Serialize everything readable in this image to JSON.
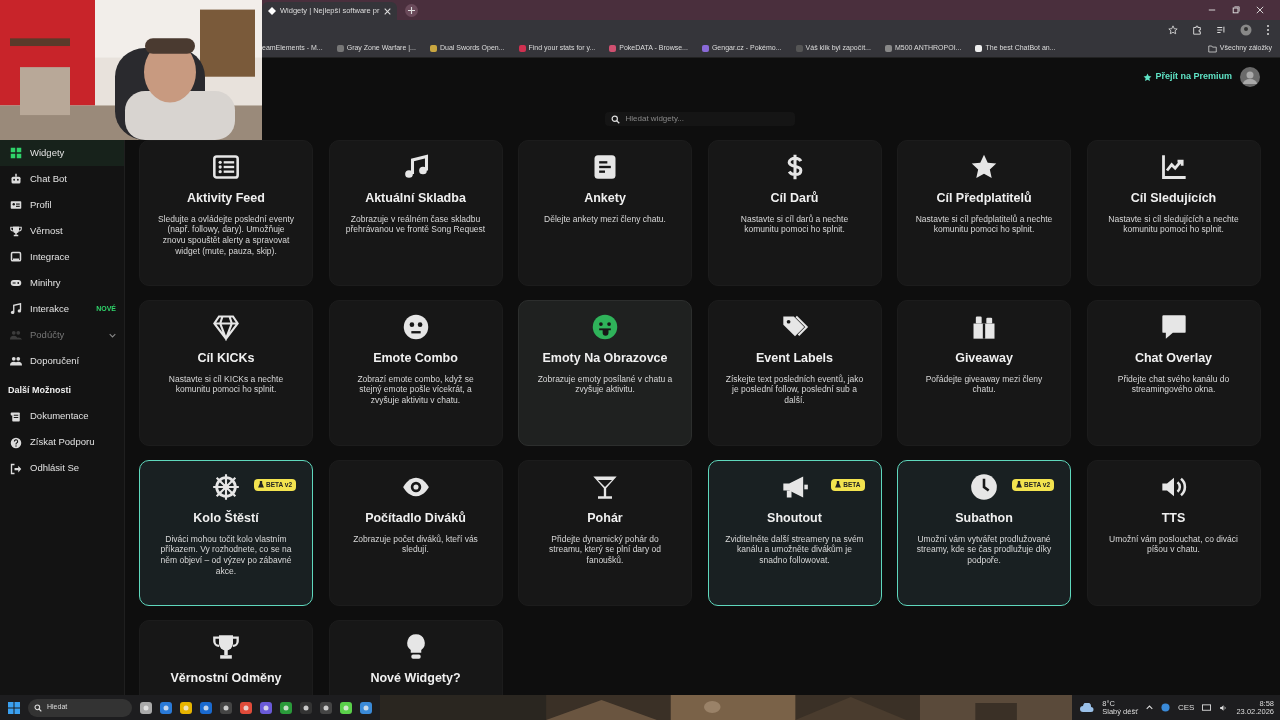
{
  "browser": {
    "tabs": [
      {
        "title": "Widgety | Nejlepší software pr",
        "selected": true
      }
    ],
    "bookmarks": [
      "eamElements - M...",
      "Gray Zone Warfare |...",
      "Dual Swords Open...",
      "Find your stats for y...",
      "PokeDATA - Browse...",
      "Gengar.cz - Pokémo...",
      "Váš klik byl započít...",
      "M500 ANTHROPOI...",
      "The best ChatBot an..."
    ],
    "all_bookmarks": "Všechny záložky"
  },
  "header": {
    "premium": "Přejít na Premium",
    "search": {
      "placeholder": "Hledat widgety..."
    }
  },
  "sidebar": {
    "items": [
      {
        "label": "Widgety",
        "selected": true,
        "disabled": false,
        "expandable": false
      },
      {
        "label": "Chat Bot",
        "selected": false,
        "disabled": false,
        "expandable": false
      },
      {
        "label": "Profil",
        "selected": false,
        "disabled": false,
        "expandable": false
      },
      {
        "label": "Věrnost",
        "selected": false,
        "disabled": false,
        "expandable": false
      },
      {
        "label": "Integrace",
        "selected": false,
        "disabled": false,
        "expandable": false
      },
      {
        "label": "Minihry",
        "selected": false,
        "disabled": false,
        "expandable": false
      },
      {
        "label": "Interakce",
        "selected": false,
        "disabled": false,
        "expandable": false,
        "badge": "NOVÉ"
      },
      {
        "label": "Podúčty",
        "selected": false,
        "disabled": true,
        "expandable": true
      },
      {
        "label": "Doporučení",
        "selected": false,
        "disabled": false,
        "expandable": false
      }
    ],
    "section": "Další Možnosti",
    "more_items": [
      {
        "label": "Dokumentace"
      },
      {
        "label": "Získat Podporu"
      },
      {
        "label": "Odhlásit Se"
      }
    ]
  },
  "widgets": [
    {
      "title": "Aktivity Feed",
      "description": "Sledujte a ovládejte poslední eventy (např. followy, dary). Umožňuje znovu spouštět alerty a spravovat widget (mute, pauza, skip).",
      "highlighted": false,
      "hovered": false
    },
    {
      "title": "Aktuální Skladba",
      "description": "Zobrazuje v reálném čase skladbu přehrávanou ve frontě Song Request",
      "highlighted": false,
      "hovered": false
    },
    {
      "title": "Ankety",
      "description": "Dělejte ankety mezi členy chatu.",
      "highlighted": false,
      "hovered": false
    },
    {
      "title": "Cíl Darů",
      "description": "Nastavte si cíl darů a nechte komunitu pomoci ho splnit.",
      "highlighted": false,
      "hovered": false
    },
    {
      "title": "Cíl Předplatitelů",
      "description": "Nastavte si cíl předplatitelů a nechte komunitu pomoci ho splnit.",
      "highlighted": false,
      "hovered": false
    },
    {
      "title": "Cíl Sledujících",
      "description": "Nastavte si cíl sledujících a nechte komunitu pomoci ho splnit.",
      "highlighted": false,
      "hovered": false
    },
    {
      "title": "Cíl KICKs",
      "description": "Nastavte si cíl KICKs a nechte komunitu pomoci ho splnit.",
      "highlighted": false,
      "hovered": false
    },
    {
      "title": "Emote Combo",
      "description": "Zobrazí emote combo, když se stejný emote pošle vícekrát, a zvyšuje aktivitu v chatu.",
      "highlighted": false,
      "hovered": false
    },
    {
      "title": "Emoty Na Obrazovce",
      "description": "Zobrazuje emoty posílané v chatu a zvyšuje aktivitu.",
      "highlighted": false,
      "hovered": true
    },
    {
      "title": "Event Labels",
      "description": "Získejte text posledních eventů, jako je poslední follow, poslední sub a další.",
      "highlighted": false,
      "hovered": false
    },
    {
      "title": "Giveaway",
      "description": "Pořádejte giveaway mezi členy chatu.",
      "highlighted": false,
      "hovered": false
    },
    {
      "title": "Chat Overlay",
      "description": "Přidejte chat svého kanálu do streamingového okna.",
      "highlighted": false,
      "hovered": false
    },
    {
      "title": "Kolo Štěstí",
      "description": "Diváci mohou točit kolo vlastním příkazem. Vy rozhodnete, co se na něm objeví – od výzev po zábavné akce.",
      "highlighted": true,
      "hovered": false,
      "badge": "BETA v2"
    },
    {
      "title": "Počítadlo Diváků",
      "description": "Zobrazuje počet diváků, kteří vás sledují.",
      "highlighted": false,
      "hovered": false
    },
    {
      "title": "Pohár",
      "description": "Přidejte dynamický pohár do streamu, který se plní dary od fanoušků.",
      "highlighted": false,
      "hovered": false
    },
    {
      "title": "Shoutout",
      "description": "Zviditelněte další streamery na svém kanálu a umožněte divákům je snadno followovat.",
      "highlighted": true,
      "hovered": false,
      "badge": "BETA"
    },
    {
      "title": "Subathon",
      "description": "Umožní vám vytvářet prodlužované streamy, kde se čas prodlužuje díky podpoře.",
      "highlighted": true,
      "hovered": false,
      "badge": "BETA v2"
    },
    {
      "title": "TTS",
      "description": "Umožní vám poslouchat, co diváci píšou v chatu.",
      "highlighted": false,
      "hovered": false
    },
    {
      "title": "Věrnostní Odměny",
      "highlighted": false,
      "hovered": false
    },
    {
      "title": "Nové Widgety?",
      "highlighted": false,
      "hovered": false
    }
  ],
  "taskbar": {
    "search": {
      "placeholder": "Hledat"
    },
    "weather": {
      "temperature": "8°C",
      "condition": "Slabý déšť"
    },
    "language": "CES",
    "time": "8:58",
    "date": "23.02.2026"
  }
}
